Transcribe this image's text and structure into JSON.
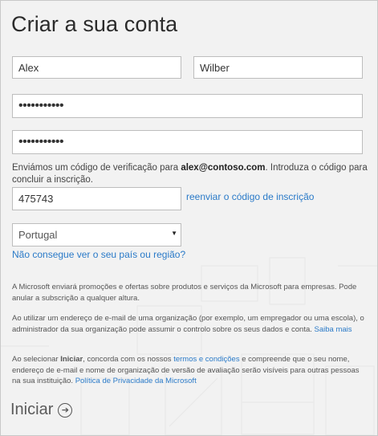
{
  "form": {
    "title": "Criar a sua conta",
    "first_name": "Alex",
    "last_name": "Wilber",
    "password_mask": "•••••••••••",
    "confirm_password_mask": "•••••••••••",
    "verification_text_before": "Enviámos um código de verificação para ",
    "email": "alex@contoso.com",
    "verification_text_after": ". Introduza o código para concluir a inscrição.",
    "verification_code": "475743",
    "resend_link": "reenviar o código de inscrição",
    "country_selected": "Portugal",
    "country_help_link": "Não consegue ver o seu país ou região?",
    "promo_notice": "A Microsoft enviará promoções e ofertas sobre produtos e serviços da Microsoft para empresas. Pode anular a subscrição a qualquer altura.",
    "org_notice": "Ao utilizar um endereço de e-mail de uma organização (por exemplo, um empregador ou uma escola), o administrador da sua organização pode assumir o controlo sobre os seus dados e conta.",
    "learn_more_link": "Saiba mais",
    "consent_prefix": "Ao selecionar ",
    "consent_start_word": "Iniciar",
    "consent_middle": ", concorda com os nossos ",
    "terms_link": "termos e condições",
    "consent_suffix": " e compreende que o seu nome, endereço de e-mail e nome de organização de versão de avaliação serão visíveis para outras pessoas na sua instituição.",
    "privacy_link": "Política de Privacidade da Microsoft",
    "start_button": "Iniciar",
    "start_icon": "arrow-right-circle-icon"
  },
  "colors": {
    "background": "#f2f2f2",
    "link": "#2a7ac8",
    "field_border": "#bdbdbd"
  }
}
